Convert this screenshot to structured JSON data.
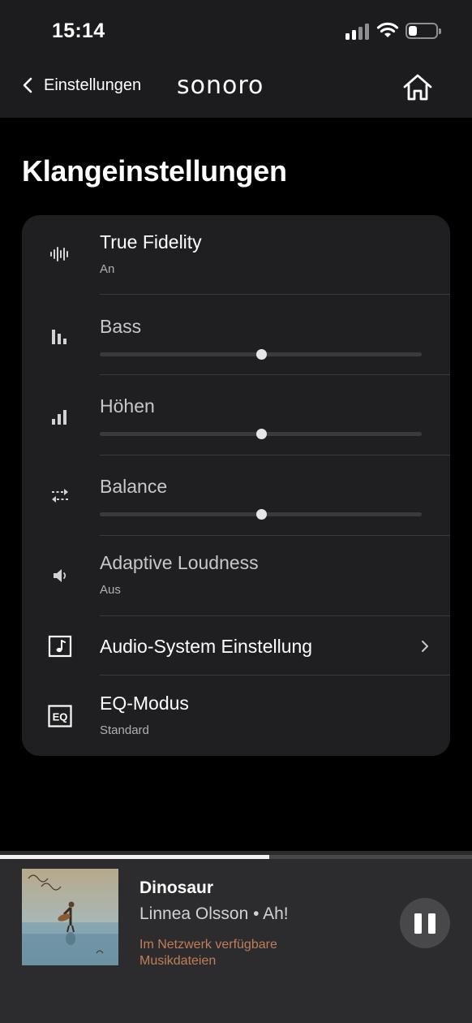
{
  "status_bar": {
    "time": "15:14"
  },
  "nav": {
    "back_label": "Einstellungen",
    "brand": "sonoro"
  },
  "page": {
    "title": "Klangeinstellungen"
  },
  "settings": {
    "true_fidelity": {
      "label": "True Fidelity",
      "value": "An",
      "icon": "waveform-icon"
    },
    "bass": {
      "label": "Bass",
      "level": 0.5,
      "icon": "bars-icon"
    },
    "treble": {
      "label": "Höhen",
      "level": 0.5,
      "icon": "signal-bars-icon"
    },
    "balance": {
      "label": "Balance",
      "level": 0.5,
      "icon": "arrows-left-right-icon"
    },
    "adaptive_loudness": {
      "label": "Adaptive Loudness",
      "value": "Aus",
      "icon": "speaker-icon"
    },
    "audio_system": {
      "label": "Audio-System Einstellung",
      "icon": "music-note-icon"
    },
    "eq_mode": {
      "label": "EQ-Modus",
      "value": "Standard",
      "icon": "eq-icon",
      "icon_text": "EQ"
    }
  },
  "player": {
    "progress": 0.57,
    "title": "Dinosaur",
    "artist_album": "Linnea Olsson • Ah!",
    "source": "Im Netzwerk verfügbare Musikdateien",
    "accent_color": "#c27d57"
  }
}
